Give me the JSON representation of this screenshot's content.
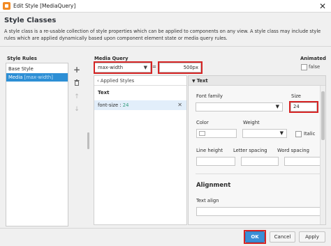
{
  "window": {
    "title": "Edit Style [MediaQuery]",
    "close_icon": "close-icon"
  },
  "header": {
    "title": "Style Classes",
    "description": "A style class is a re-usable collection of style properties which can be applied to components on any view. A style class may include style rules which are applied dynamically based upon component element state or media query rules."
  },
  "style_rules": {
    "label": "Style Rules",
    "items": [
      {
        "label": "Base Style",
        "sub": ""
      },
      {
        "label": "Media",
        "sub": "[max-width]"
      }
    ],
    "actions": [
      "add-icon",
      "trash-icon",
      "arrow-up-icon",
      "arrow-down-icon"
    ]
  },
  "media_query": {
    "label": "Media Query",
    "type": "max-width",
    "operator": "=",
    "value": "500px"
  },
  "animated": {
    "label": "Animated",
    "value": "false"
  },
  "applied_styles": {
    "header": "Applied Styles",
    "category": "Text",
    "row": {
      "prop": "font-size",
      "sep": " : ",
      "val": "24"
    }
  },
  "properties": {
    "section": "Text",
    "font_family_label": "Font family",
    "font_family_value": "",
    "size_label": "Size",
    "size_value": "24",
    "color_label": "Color",
    "weight_label": "Weight",
    "italic_label": "Italic",
    "line_height_label": "Line height",
    "letter_spacing_label": "Letter spacing",
    "word_spacing_label": "Word spacing",
    "alignment_title": "Alignment",
    "text_align_label": "Text align"
  },
  "buttons": {
    "ok": "OK",
    "cancel": "Cancel",
    "apply": "Apply"
  },
  "colors": {
    "accent": "#2d8fd5",
    "highlight": "#d62424",
    "value_green": "#2f9a7a"
  }
}
